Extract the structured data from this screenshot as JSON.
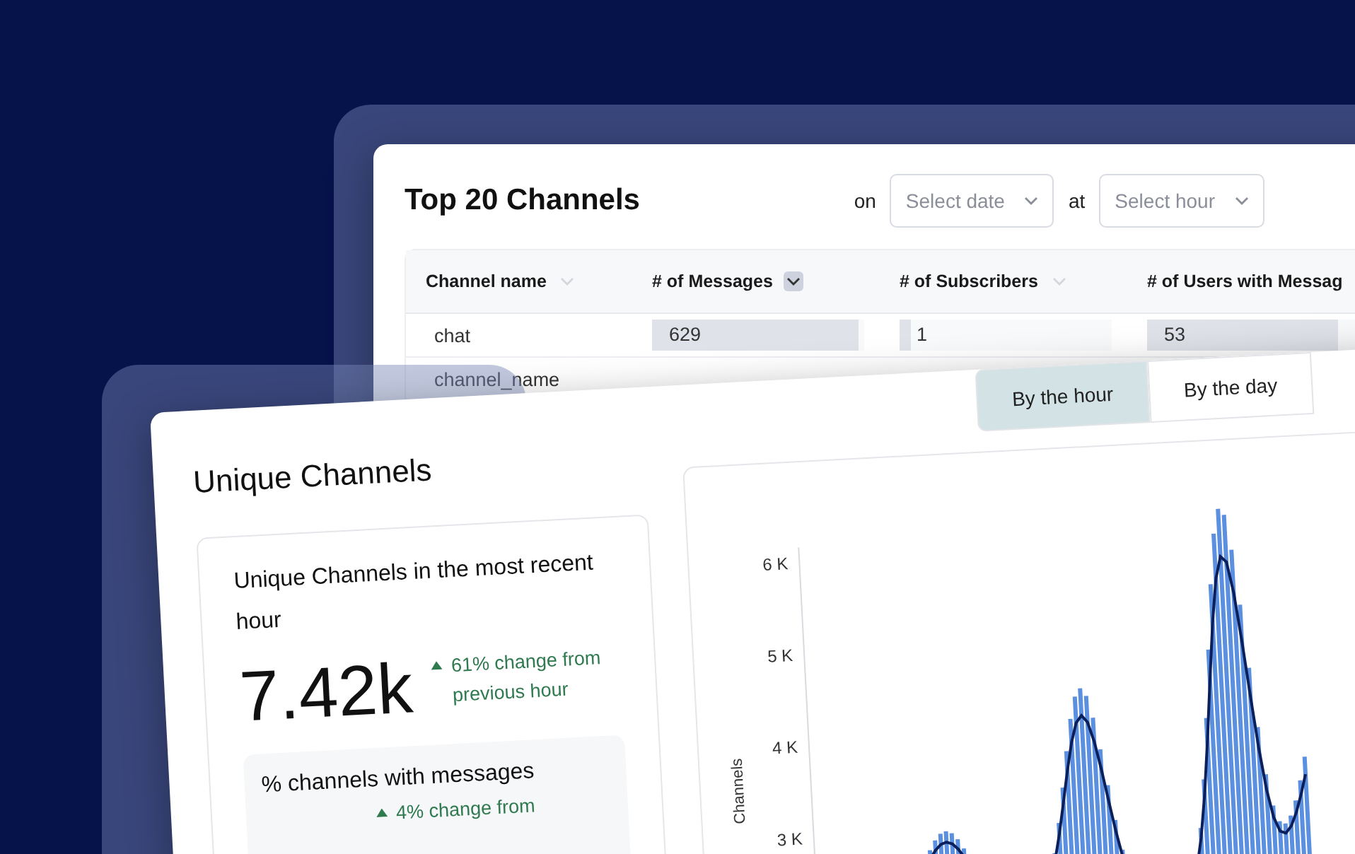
{
  "top_channels": {
    "title": "Top 20 Channels",
    "filters": [
      {
        "prefix": "on",
        "placeholder": "Select date"
      },
      {
        "prefix": "at",
        "placeholder": "Select hour"
      }
    ],
    "columns": [
      {
        "label": "Channel name",
        "sorted": false
      },
      {
        "label": "# of Messages",
        "sorted": true
      },
      {
        "label": "# of Subscribers",
        "sorted": false
      },
      {
        "label": "# of Users with Messag"
      }
    ],
    "rows": [
      {
        "cells": [
          {
            "value": "chat"
          },
          {
            "value": "629",
            "level": 0.97
          },
          {
            "value": "1",
            "level": 0.05
          },
          {
            "value": "53",
            "level": 0.9
          }
        ]
      },
      {
        "cells": [
          {
            "value": "channel_name"
          }
        ]
      }
    ]
  },
  "unique_channels": {
    "title": "Unique Channels",
    "tabs": [
      {
        "label": "By the hour",
        "selected": true
      },
      {
        "label": "By the day",
        "selected": false
      }
    ],
    "stat": {
      "title": "Unique Channels in the most recent hour",
      "value": "7.42k",
      "change": "61% change from previous hour"
    },
    "sub_stat": {
      "title": "% channels with messages",
      "change": "4% change from"
    },
    "chart": {
      "y_label": "Channels",
      "y_ticks": [
        "6 K",
        "5 K",
        "4 K",
        "3 K"
      ]
    }
  }
}
